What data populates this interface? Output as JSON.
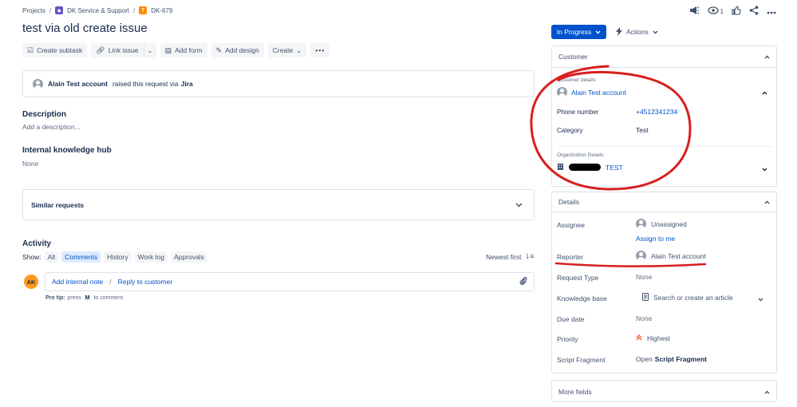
{
  "breadcrumb": {
    "projects": "Projects",
    "project": "DK Service & Support",
    "issue_key": "DK-679"
  },
  "header": {
    "watch_count": "1"
  },
  "issue": {
    "title": "test via old create issue"
  },
  "toolbar": {
    "create_subtask": "Create subtask",
    "link_issue": "Link issue",
    "add_form": "Add form",
    "add_design": "Add design",
    "create": "Create"
  },
  "raised": {
    "user": "Alain Test account",
    "text": "raised this request via",
    "channel": "Jira"
  },
  "description": {
    "heading": "Description",
    "placeholder": "Add a description..."
  },
  "knowledge_hub": {
    "heading": "Internal knowledge hub",
    "value": "None"
  },
  "similar": {
    "label": "Similar requests"
  },
  "activity": {
    "heading": "Activity",
    "show_label": "Show:",
    "filters": [
      "All",
      "Comments",
      "History",
      "Work log",
      "Approvals"
    ],
    "sort_label": "Newest first",
    "avatar_initials": "AK",
    "add_internal_note": "Add internal note",
    "separator": "/",
    "reply_to_customer": "Reply to customer",
    "protip_prefix": "Pro tip:",
    "protip_press": "press",
    "protip_key": "M",
    "protip_suffix": "to comment"
  },
  "status": {
    "label": "In Progress",
    "actions_label": "Actions"
  },
  "customer_panel": {
    "heading": "Customer",
    "details_label": "Customer details",
    "customer_name": "Alain Test account",
    "phone_label": "Phone number",
    "phone_value": "+4512341234",
    "category_label": "Category",
    "category_value": "Test",
    "org_label": "Organization Details",
    "org_value": "TEST"
  },
  "details_panel": {
    "heading": "Details",
    "assignee_label": "Assignee",
    "assignee_value": "Unassigned",
    "assign_to_me": "Assign to me",
    "reporter_label": "Reporter",
    "reporter_value": "Alain Test account",
    "request_type_label": "Request Type",
    "request_type_value": "None",
    "kb_label": "Knowledge base",
    "kb_value": "Search or create an article",
    "due_date_label": "Due date",
    "due_date_value": "None",
    "priority_label": "Priority",
    "priority_value": "Highest",
    "script_label": "Script Fragment",
    "script_value_prefix": "Open",
    "script_value_bold": "Script Fragment"
  },
  "more_fields": {
    "heading": "More fields"
  },
  "colors": {
    "primary": "#0052cc",
    "annotation": "#d81e1e",
    "priority": "#ff5630"
  }
}
